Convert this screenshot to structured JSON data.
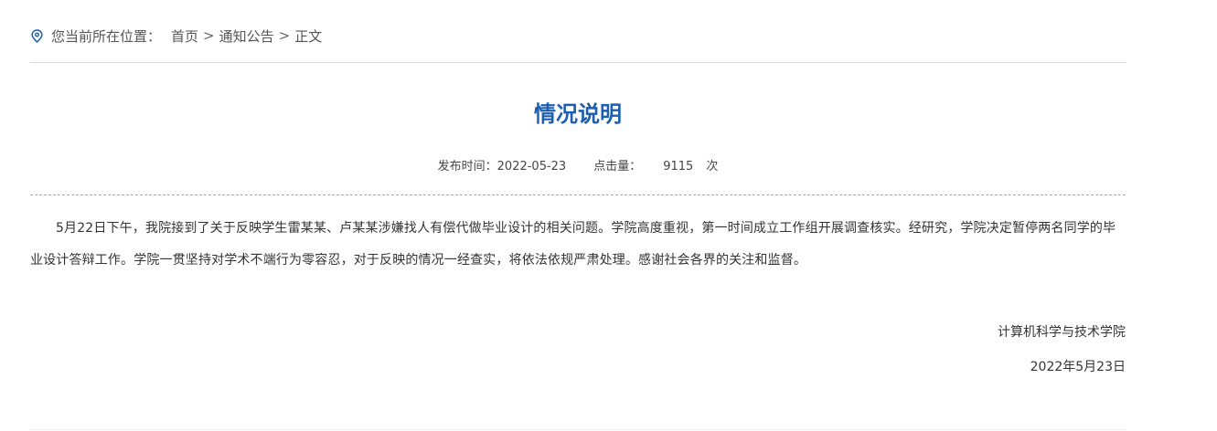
{
  "breadcrumb": {
    "icon": "location-pin-icon",
    "label": "您当前所在位置：",
    "items": [
      "首页",
      "通知公告",
      "正文"
    ],
    "separator": ">"
  },
  "article": {
    "title": "情况说明",
    "meta": {
      "publish_label": "发布时间：",
      "publish_date": "2022-05-23",
      "views_label": "点击量：",
      "views_count": "9115",
      "views_unit": "次"
    },
    "body": "5月22日下午，我院接到了关于反映学生雷某某、卢某某涉嫌找人有偿代做毕业设计的相关问题。学院高度重视，第一时间成立工作组开展调查核实。经研究，学院决定暂停两名同学的毕业设计答辩工作。学院一贯坚持对学术不端行为零容忍，对于反映的情况一经查实，将依法依规严肃处理。感谢社会各界的关注和监督。",
    "signature_org": "计算机科学与技术学院",
    "signature_date": "2022年5月23日"
  },
  "colors": {
    "title": "#1c5fb0",
    "icon": "#1c5fb0",
    "text": "#333333"
  }
}
